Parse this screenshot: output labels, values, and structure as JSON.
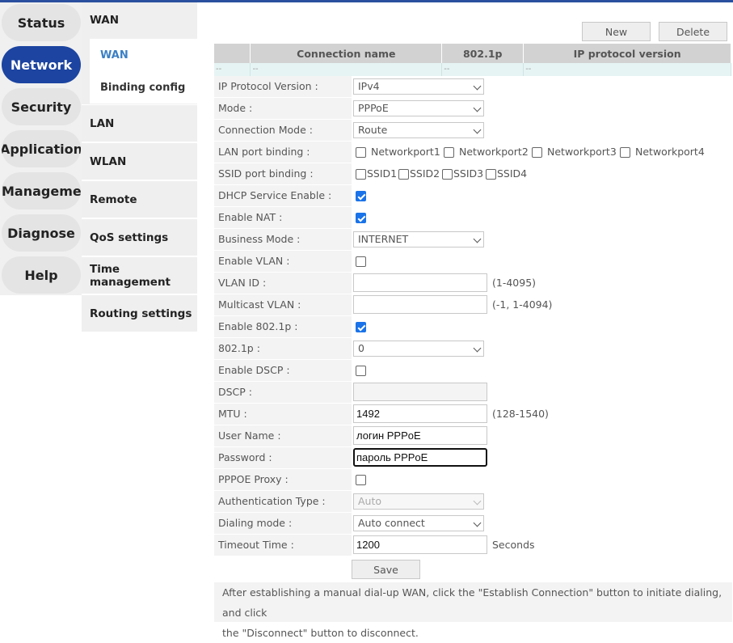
{
  "main_menu": [
    "Status",
    "Network",
    "Security",
    "Application",
    "Managemen",
    "Diagnose",
    "Help"
  ],
  "sub_menu": {
    "wan": "WAN",
    "wan_children": [
      "WAN",
      "Binding config"
    ],
    "items": [
      "LAN",
      "WLAN",
      "Remote",
      "QoS settings",
      "Time management",
      "Routing settings"
    ]
  },
  "toolbar": {
    "new_label": "New",
    "delete_label": "Delete"
  },
  "table": {
    "headers": [
      "",
      "Connection name",
      "802.1p",
      "IP protocol version"
    ],
    "row": [
      "--",
      "--",
      "--",
      "--"
    ]
  },
  "form": {
    "ip_protocol_version": {
      "label": "IP Protocol Version :",
      "value": "IPv4"
    },
    "mode": {
      "label": "Mode :",
      "value": "PPPoE"
    },
    "connection_mode": {
      "label": "Connection Mode :",
      "value": "Route"
    },
    "lan_port_binding": {
      "label": "LAN port binding :",
      "options": [
        "Networkport1",
        "Networkport2",
        "Networkport3",
        "Networkport4"
      ]
    },
    "ssid_port_binding": {
      "label": "SSID port binding :",
      "options": [
        "SSID1",
        "SSID2",
        "SSID3",
        "SSID4"
      ]
    },
    "dhcp_service_enable": {
      "label": "DHCP Service Enable :",
      "checked": true
    },
    "enable_nat": {
      "label": "Enable NAT :",
      "checked": true
    },
    "business_mode": {
      "label": "Business Mode :",
      "value": "INTERNET"
    },
    "enable_vlan": {
      "label": "Enable VLAN :",
      "checked": false
    },
    "vlan_id": {
      "label": "VLAN ID :",
      "value": "",
      "hint": "(1-4095)"
    },
    "multicast_vlan": {
      "label": "Multicast VLAN :",
      "value": "",
      "hint": "(-1, 1-4094)"
    },
    "enable_8021p": {
      "label": "Enable 802.1p :",
      "checked": true
    },
    "p8021": {
      "label": "802.1p :",
      "value": "0"
    },
    "enable_dscp": {
      "label": "Enable DSCP :",
      "checked": false
    },
    "dscp": {
      "label": "DSCP :",
      "value": ""
    },
    "mtu": {
      "label": "MTU :",
      "value": "1492",
      "hint": "(128-1540)"
    },
    "user_name": {
      "label": "User Name :",
      "value": "логин PPPoE"
    },
    "password": {
      "label": "Password :",
      "value": "пароль PPPoE"
    },
    "pppoe_proxy": {
      "label": "PPPOE Proxy :",
      "checked": false
    },
    "authentication_type": {
      "label": "Authentication Type :",
      "value": "Auto"
    },
    "dialing_mode": {
      "label": "Dialing mode :",
      "value": "Auto connect"
    },
    "timeout_time": {
      "label": "Timeout Time :",
      "value": "1200",
      "hint": "Seconds"
    },
    "save_label": "Save"
  },
  "note": {
    "line1": "After establishing a manual dial-up WAN, click the \"Establish Connection\" button to initiate dialing, and click",
    "line2": "the \"Disconnect\" button to disconnect."
  },
  "colors": {
    "accent": "#1c44a0",
    "checkbox": "#1a73e8",
    "submenu_active": "#3a7fc4"
  }
}
